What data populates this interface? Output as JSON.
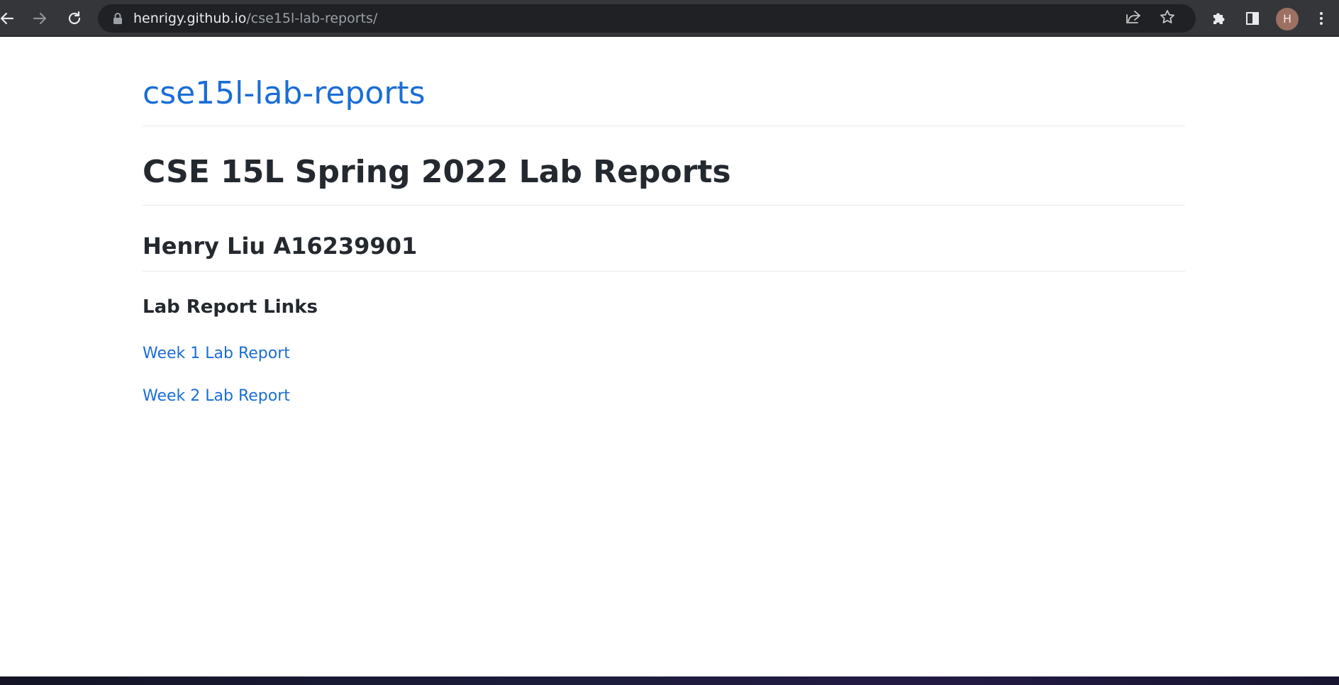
{
  "browser": {
    "url_host": "henrigy.github.io",
    "url_path": "/cse15l-lab-reports/",
    "profile_initial": "H",
    "icons": {
      "back": "arrow-left-icon",
      "forward": "arrow-right-icon",
      "reload": "reload-icon",
      "lock": "lock-icon",
      "share": "share-icon",
      "bookmark": "star-icon",
      "extensions": "puzzle-icon",
      "side_panel": "side-panel-icon",
      "menu": "kebab-menu-icon"
    }
  },
  "page": {
    "site_title": "cse15l-lab-reports",
    "heading": "CSE 15L Spring 2022 Lab Reports",
    "subheading": "Henry Liu A16239901",
    "section_title": "Lab Report Links",
    "links": [
      {
        "label": "Week 1 Lab Report"
      },
      {
        "label": "Week 2 Lab Report"
      }
    ]
  },
  "colors": {
    "chrome_toolbar": "#35363a",
    "omnibox": "#202124",
    "link": "#1a6dd6",
    "heading_text": "#24292f",
    "divider": "#e8eaed",
    "avatar": "#9c7062"
  }
}
